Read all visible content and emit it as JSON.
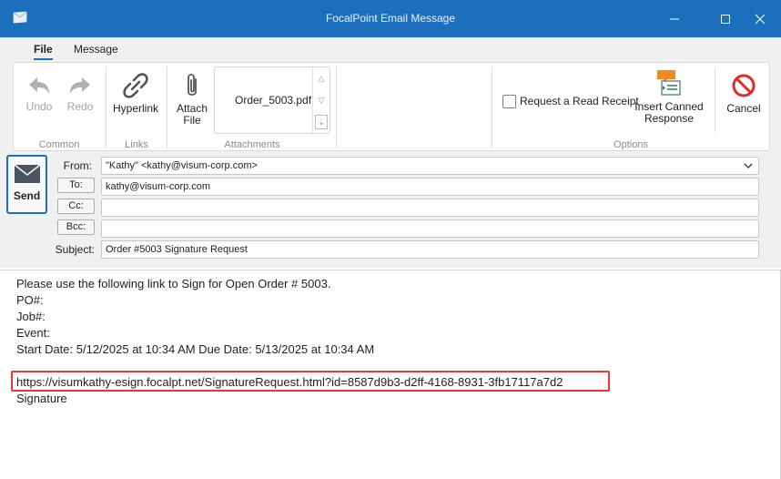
{
  "window": {
    "title": "FocalPoint Email Message"
  },
  "menu": {
    "tabs": [
      "File",
      "Message"
    ]
  },
  "ribbon": {
    "common": {
      "label": "Common",
      "undo_label": "Undo",
      "redo_label": "Redo"
    },
    "links": {
      "label": "Links",
      "hyperlink_label": "Hyperlink"
    },
    "attachments": {
      "label": "Attachments",
      "attach_file_line1": "Attach",
      "attach_file_line2": "File",
      "files": [
        "Order_5003.pdf"
      ]
    },
    "options": {
      "label": "Options",
      "read_receipt_label": "Request a Read Receipt",
      "read_receipt_checked": false,
      "canned_line1": "Insert Canned",
      "canned_line2": "Response",
      "cancel_label": "Cancel"
    }
  },
  "header": {
    "send_label": "Send",
    "from_label": "From:",
    "from_value": "\"Kathy\" <kathy@visum-corp.com>",
    "to_label": "To:",
    "to_value": "kathy@visum-corp.com",
    "cc_label": "Cc:",
    "cc_value": "",
    "bcc_label": "Bcc:",
    "bcc_value": "",
    "subject_label": "Subject:",
    "subject_value": "Order #5003 Signature Request"
  },
  "message_body": {
    "lines": [
      "Please use the following link to Sign for Open Order # 5003.",
      "PO#:",
      "Job#:",
      "Event:",
      "Start Date: 5/12/2025 at 10:34 AM Due Date: 5/13/2025 at 10:34 AM",
      "",
      "https://visumkathy-esign.focalpt.net/SignatureRequest.html?id=8587d9b3-d2ff-4168-8931-3fb17117a7d2",
      "Signature"
    ]
  },
  "colors": {
    "accent": "#1c6fbd",
    "highlight": "#e53935",
    "cancel_icon": "#e02b2b",
    "canned_icon": "#f08a1c"
  }
}
